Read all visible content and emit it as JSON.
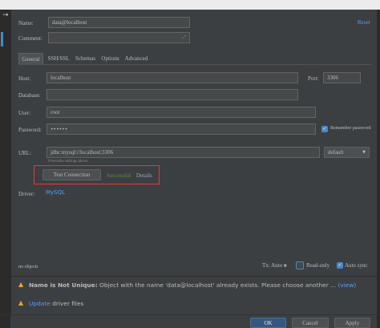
{
  "rail": {
    "arrow_icon": "arrow-right-icon"
  },
  "header": {
    "reset_link": "Reset"
  },
  "form": {
    "name_label": "Name:",
    "name_value": "data@localhost",
    "comment_label": "Comment:",
    "comment_value": ""
  },
  "tabs": [
    {
      "label": "General",
      "active": true
    },
    {
      "label": "SSH/SSL",
      "active": false
    },
    {
      "label": "Schemas",
      "active": false
    },
    {
      "label": "Options",
      "active": false
    },
    {
      "label": "Advanced",
      "active": false
    }
  ],
  "general": {
    "host_label": "Host:",
    "host_value": "localhost",
    "port_label": "Port:",
    "port_value": "3306",
    "database_label": "Database:",
    "database_value": "",
    "user_label": "User:",
    "user_value": "root",
    "password_label": "Password:",
    "password_value": "••••••",
    "remember_label": "Remember password",
    "remember_checked": true,
    "url_label": "URL:",
    "url_value": "jdbc:mysql://localhost:3306",
    "url_hint": "Overrides settings above",
    "url_mode": "default",
    "test_button": "Test Connection",
    "test_status": "Successful",
    "details_link": "Details",
    "driver_label": "Driver:",
    "driver_value": "MySQL"
  },
  "bottom": {
    "objects_label": "no objects",
    "tx_label": "Tx: Auto",
    "readonly_label": "Read-only",
    "readonly_checked": false,
    "autosync_label": "Auto sync",
    "autosync_checked": true
  },
  "warnings": [
    {
      "title": "Name is Not Unique:",
      "message": "Object with the name 'data@localhost' already exists. Please choose another ...",
      "link": "(view)"
    },
    {
      "link": "Update",
      "message": "driver files"
    }
  ],
  "footer": {
    "ok": "OK",
    "cancel": "Cancel",
    "apply": "Apply"
  },
  "colors": {
    "background": "#3c3f41",
    "accent": "#4a88c7",
    "success": "#5e8d3a",
    "warning": "#e6a431",
    "highlight_box": "#e03c3c"
  }
}
